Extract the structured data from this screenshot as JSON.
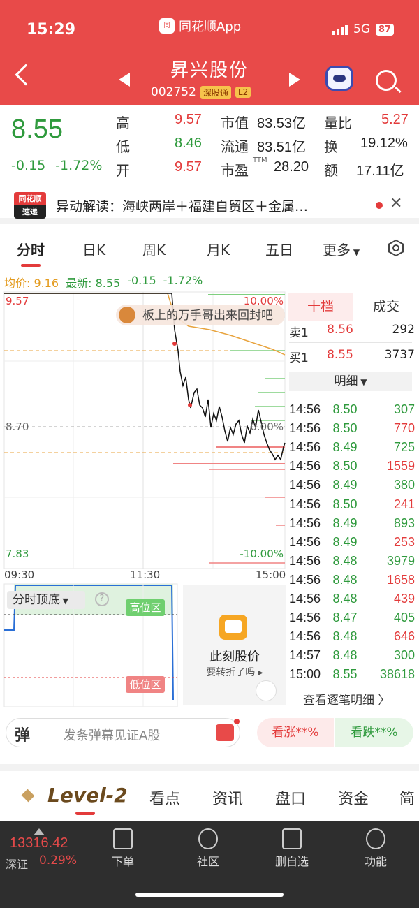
{
  "status": {
    "time": "15:29",
    "app": "同花顺App",
    "network": "5G",
    "battery": "87"
  },
  "stock": {
    "name": "昇兴股份",
    "code": "002752",
    "tag1": "深股通",
    "tag2": "L2"
  },
  "quote": {
    "price": "8.55",
    "change": "-0.15",
    "change_pct": "-1.72%",
    "high_label": "高",
    "high": "9.57",
    "low_label": "低",
    "low": "8.46",
    "open_label": "开",
    "open": "9.57",
    "mktcap_label": "市值",
    "mktcap": "83.53亿",
    "float_label": "流通",
    "float": "83.51亿",
    "pe_label": "市盈",
    "pe_sup": "TTM",
    "pe": "28.20",
    "volratio_label": "量比",
    "volratio": "5.27",
    "turnover_label": "换",
    "turnover": "19.12%",
    "amount_label": "额",
    "amount": "17.11亿"
  },
  "news": {
    "logo_top": "同花顺",
    "logo_bottom": "速递",
    "text": "异动解读：海峡两岸＋福建自贸区＋金属…"
  },
  "ktabs": [
    "分时",
    "日K",
    "周K",
    "月K",
    "五日",
    "更多"
  ],
  "avg_bar": {
    "avg": "均价: 9.16",
    "latest": "最新: 8.55",
    "chg": "-0.15",
    "pct": "-1.72%"
  },
  "chart_labels": {
    "top_price": "9.57",
    "mid_price": "8.70",
    "bottom_price": "7.83",
    "top_pct": "10.00%",
    "mid_pct": "0.00%",
    "bottom_pct": "-10.00%",
    "t_start": "09:30",
    "t_mid": "11:30",
    "t_end": "15:00",
    "bubble": "板上的万手哥出来回封吧"
  },
  "book": {
    "tab_active": "十档",
    "tab_other": "成交",
    "sell1_label": "卖1",
    "sell1_price": "8.56",
    "sell1_vol": "292",
    "buy1_label": "买1",
    "buy1_price": "8.55",
    "buy1_vol": "3737",
    "detail": "明细"
  },
  "trades": [
    {
      "t": "14:56",
      "p": "8.50",
      "v": "307",
      "c": "green"
    },
    {
      "t": "14:56",
      "p": "8.50",
      "v": "770",
      "c": "red"
    },
    {
      "t": "14:56",
      "p": "8.49",
      "v": "725",
      "c": "green"
    },
    {
      "t": "14:56",
      "p": "8.50",
      "v": "1559",
      "c": "red"
    },
    {
      "t": "14:56",
      "p": "8.49",
      "v": "380",
      "c": "green"
    },
    {
      "t": "14:56",
      "p": "8.50",
      "v": "241",
      "c": "red"
    },
    {
      "t": "14:56",
      "p": "8.49",
      "v": "893",
      "c": "green"
    },
    {
      "t": "14:56",
      "p": "8.49",
      "v": "253",
      "c": "red"
    },
    {
      "t": "14:56",
      "p": "8.48",
      "v": "3979",
      "c": "green"
    },
    {
      "t": "14:56",
      "p": "8.48",
      "v": "1658",
      "c": "red"
    },
    {
      "t": "14:56",
      "p": "8.48",
      "v": "439",
      "c": "red"
    },
    {
      "t": "14:56",
      "p": "8.47",
      "v": "405",
      "c": "green"
    },
    {
      "t": "14:56",
      "p": "8.48",
      "v": "646",
      "c": "red"
    },
    {
      "t": "14:57",
      "p": "8.48",
      "v": "300",
      "c": "green"
    },
    {
      "t": "15:00",
      "p": "8.55",
      "v": "38618",
      "c": "green"
    }
  ],
  "view_all": "查看逐笔明细 〉",
  "indicator": {
    "label": "分时顶底",
    "help": "?",
    "high": "高位区",
    "low": "低位区"
  },
  "ad": {
    "title": "此刻股价",
    "sub": "要转折了吗 ▸"
  },
  "danmu": {
    "badge": "弹",
    "placeholder": "发条弹幕见证A股",
    "bull": "看涨**%",
    "bear": "看跌**%"
  },
  "bottom_tabs": {
    "level2": "Level-2",
    "items": [
      "看点",
      "资讯",
      "盘口",
      "资金",
      "简"
    ]
  },
  "footer": {
    "index_value": "13316.42",
    "index_name": "深证",
    "index_chg": "0.29%",
    "items": [
      "下单",
      "社区",
      "删自选",
      "功能"
    ]
  },
  "colors": {
    "up": "#e33b3b",
    "down": "#2f9a3d",
    "header": "#e84a49"
  }
}
